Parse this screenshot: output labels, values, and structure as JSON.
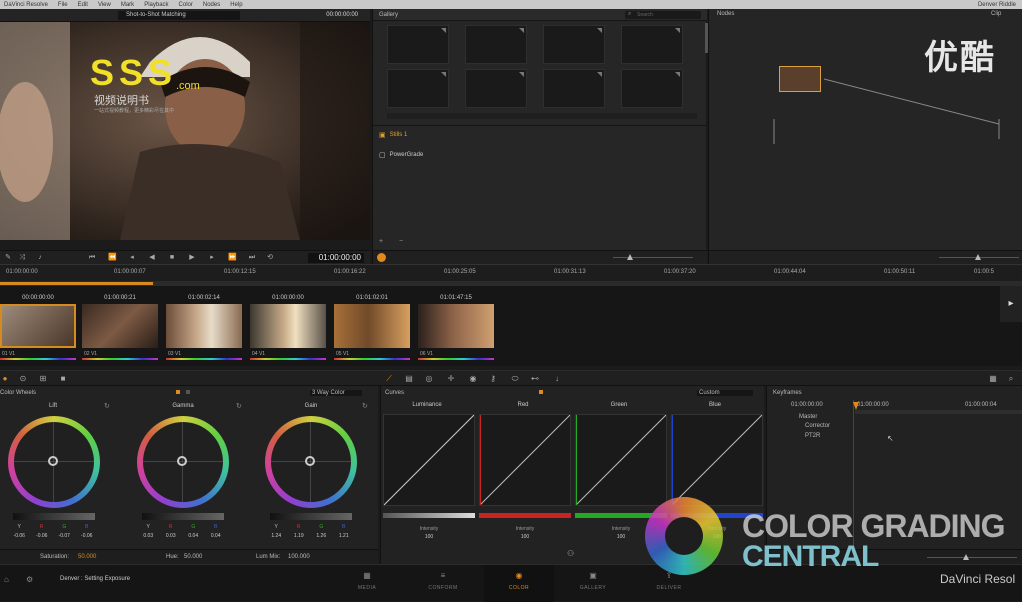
{
  "menubar": {
    "app": "DaVinci Resolve",
    "items": [
      "File",
      "Edit",
      "View",
      "Mark",
      "Playback",
      "Color",
      "Nodes",
      "Help"
    ],
    "user": "Denver Riddle"
  },
  "viewer": {
    "mode": "Shot-to-Shot Matching",
    "header_timecode": "00:00:00:00",
    "timecode": "01:00:00:00"
  },
  "gallery": {
    "title": "Gallery",
    "search_placeholder": "Search",
    "albums": [
      {
        "label": "Stills 1",
        "icon": "stills-album-icon",
        "active_color": "#e0a030"
      },
      {
        "label": "PowerGrade",
        "icon": "powergrade-album-icon"
      }
    ]
  },
  "nodes": {
    "title": "Nodes",
    "mode": "Clip"
  },
  "timeline": {
    "ticks": [
      "01:00:00:00",
      "01:00:00:07",
      "01:00:12:15",
      "01:00:16:22",
      "01:00:25:05",
      "01:00:31:13",
      "01:00:37:20",
      "01:00:44:04",
      "01:00:50:11",
      "01:00:5"
    ],
    "progress_fraction": 0.15,
    "progress_color": "#d88a1e"
  },
  "clips": [
    {
      "tc": "00:00:00:00",
      "label": "01 V1"
    },
    {
      "tc": "01:00:00:21",
      "label": "02 V1"
    },
    {
      "tc": "01:00:02:14",
      "label": "03 V1"
    },
    {
      "tc": "01:00:00:00",
      "label": "04 V1"
    },
    {
      "tc": "01:01:02:01",
      "label": "05 V1"
    },
    {
      "tc": "01:01:47:15",
      "label": "06 V1"
    }
  ],
  "wheels": {
    "title": "Color Wheels",
    "mode": "3 Way Color",
    "items": [
      {
        "name": "Lift",
        "labels": [
          "Y",
          "R",
          "G",
          "B"
        ],
        "values": [
          "-0.06",
          "-0.06",
          "-0.07",
          "-0.06"
        ]
      },
      {
        "name": "Gamma",
        "labels": [
          "Y",
          "R",
          "G",
          "B"
        ],
        "values": [
          "0.03",
          "0.03",
          "0.04",
          "0.04"
        ]
      },
      {
        "name": "Gain",
        "labels": [
          "Y",
          "R",
          "G",
          "B"
        ],
        "values": [
          "1.24",
          "1.19",
          "1.26",
          "1.21"
        ]
      }
    ],
    "saturation_label": "Saturation:",
    "saturation_value": "50.000",
    "hue_label": "Hue:",
    "hue_value": "50.000",
    "lum_label": "Lum Mix:",
    "lum_value": "100.000"
  },
  "curves": {
    "title": "Curves",
    "mode": "Custom",
    "items": [
      {
        "name": "Luminance",
        "color": "#cccccc",
        "label": "Intensity",
        "value": "100"
      },
      {
        "name": "Red",
        "color": "#cc2222",
        "label": "Intensity",
        "value": "100"
      },
      {
        "name": "Green",
        "color": "#22aa22",
        "label": "Intensity",
        "value": "100"
      },
      {
        "name": "Blue",
        "color": "#2244cc",
        "label": "Intensity",
        "value": "100"
      }
    ]
  },
  "keyframes": {
    "title": "Keyframes",
    "timecode": "01:00:00:00",
    "ruler": [
      "01:00:00:00",
      "01:00:00:04"
    ],
    "tracks": [
      "Master",
      "Corrector",
      "PT2R"
    ]
  },
  "footer": {
    "status": "Denver : Setting Exposure",
    "pages": [
      {
        "label": "MEDIA",
        "icon": "media-icon"
      },
      {
        "label": "CONFORM",
        "icon": "conform-icon"
      },
      {
        "label": "COLOR",
        "icon": "color-icon",
        "active": true
      },
      {
        "label": "GALLERY",
        "icon": "gallery-icon"
      },
      {
        "label": "DELIVER",
        "icon": "deliver-icon"
      }
    ],
    "brand": "DaVinci Resol"
  },
  "watermarks": {
    "sss": "SSS",
    "sss_com": ".com",
    "sss_sub": "视频说明书",
    "sss_tag": "一站式视频教程，更多精彩尽在其中",
    "youku": "优酷",
    "cgc_line1": "COLOR GRADING",
    "cgc_line2": "CENTRAL"
  }
}
